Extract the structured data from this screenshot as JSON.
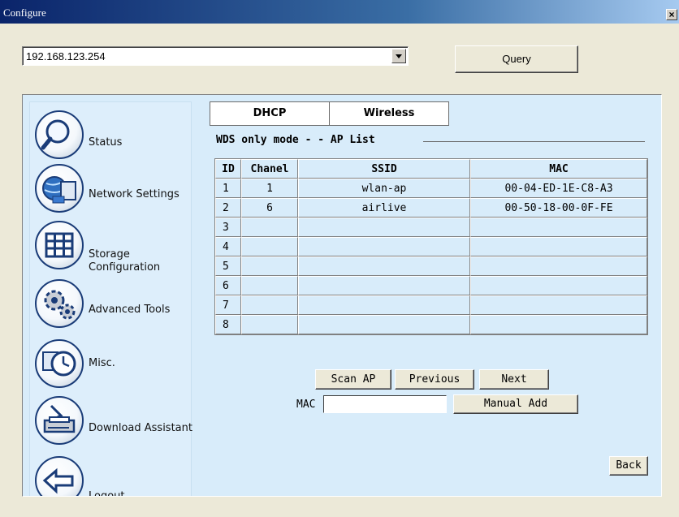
{
  "window": {
    "title": "Configure",
    "close": "×"
  },
  "address": {
    "value": "192.168.123.254",
    "query_label": "Query"
  },
  "sidebar": {
    "items": [
      {
        "label": "Status",
        "icon": "magnifier-icon"
      },
      {
        "label": "Network Settings",
        "icon": "network-globe-icon"
      },
      {
        "label": "Storage Configuration",
        "icon": "storage-grid-icon"
      },
      {
        "label": "Advanced Tools",
        "icon": "gears-icon"
      },
      {
        "label": "Misc.",
        "icon": "clock-icon"
      },
      {
        "label": "Download Assistant",
        "icon": "download-printer-icon"
      },
      {
        "label": "Logout",
        "icon": "back-arrow-icon"
      }
    ]
  },
  "tabs": [
    {
      "label": "DHCP"
    },
    {
      "label": "Wireless"
    }
  ],
  "section_title": "WDS only mode - - AP List",
  "table": {
    "headers": [
      "ID",
      "Chanel",
      "SSID",
      "MAC"
    ],
    "rows": [
      [
        "1",
        "1",
        "wlan-ap",
        "00-04-ED-1E-C8-A3"
      ],
      [
        "2",
        "6",
        "airlive",
        "00-50-18-00-0F-FE"
      ],
      [
        "3",
        "",
        "",
        ""
      ],
      [
        "4",
        "",
        "",
        ""
      ],
      [
        "5",
        "",
        "",
        ""
      ],
      [
        "6",
        "",
        "",
        ""
      ],
      [
        "7",
        "",
        "",
        ""
      ],
      [
        "8",
        "",
        "",
        ""
      ]
    ]
  },
  "buttons": {
    "scan": "Scan AP",
    "previous": "Previous",
    "next": "Next",
    "manual_add": "Manual Add",
    "back": "Back"
  },
  "mac": {
    "label": "MAC",
    "value": ""
  }
}
